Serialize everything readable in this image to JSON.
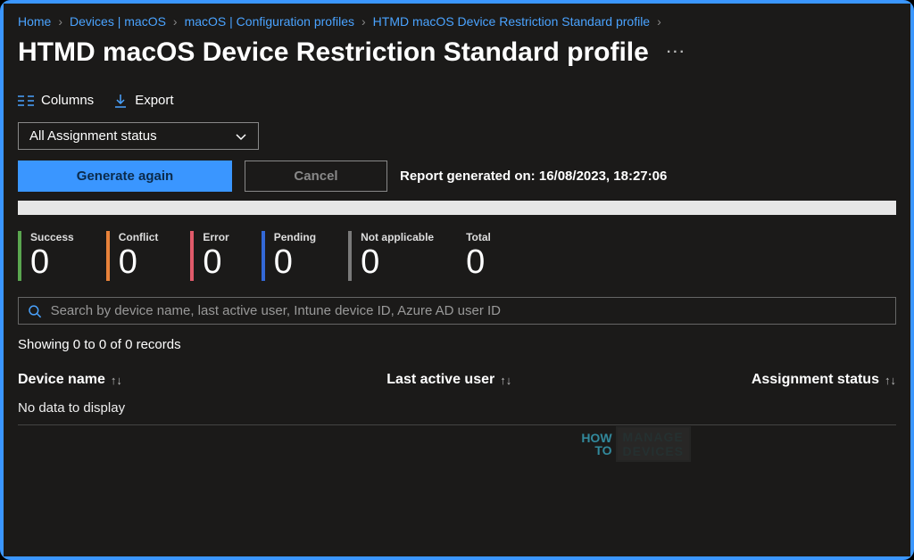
{
  "breadcrumb": {
    "items": [
      {
        "label": "Home"
      },
      {
        "label": "Devices | macOS"
      },
      {
        "label": "macOS | Configuration profiles"
      },
      {
        "label": "HTMD macOS Device Restriction Standard profile"
      }
    ]
  },
  "page": {
    "title": "HTMD macOS Device Restriction Standard profile"
  },
  "toolbar": {
    "columns_label": "Columns",
    "export_label": "Export"
  },
  "filter": {
    "assignment_status_label": "All Assignment status"
  },
  "actions": {
    "generate_label": "Generate again",
    "cancel_label": "Cancel",
    "report_prefix": "Report generated on: ",
    "report_timestamp": "16/08/2023, 18:27:06"
  },
  "stats": {
    "success": {
      "label": "Success",
      "value": "0",
      "color": "#5aa64f"
    },
    "conflict": {
      "label": "Conflict",
      "value": "0",
      "color": "#e8823a"
    },
    "error": {
      "label": "Error",
      "value": "0",
      "color": "#e05a6a"
    },
    "pending": {
      "label": "Pending",
      "value": "0",
      "color": "#3368d6"
    },
    "not_applicable": {
      "label": "Not applicable",
      "value": "0",
      "color": "#7a7a7a"
    },
    "total": {
      "label": "Total",
      "value": "0",
      "color": "transparent"
    }
  },
  "search": {
    "placeholder": "Search by device name, last active user, Intune device ID, Azure AD user ID"
  },
  "table": {
    "records_info": "Showing 0 to 0 of 0 records",
    "columns": {
      "device": "Device name",
      "user": "Last active user",
      "status": "Assignment status"
    },
    "no_data": "No data to display"
  },
  "watermark": {
    "line1": "HOW",
    "line2": "TO",
    "box1": "MANAGE",
    "box2": "DEVICES"
  }
}
